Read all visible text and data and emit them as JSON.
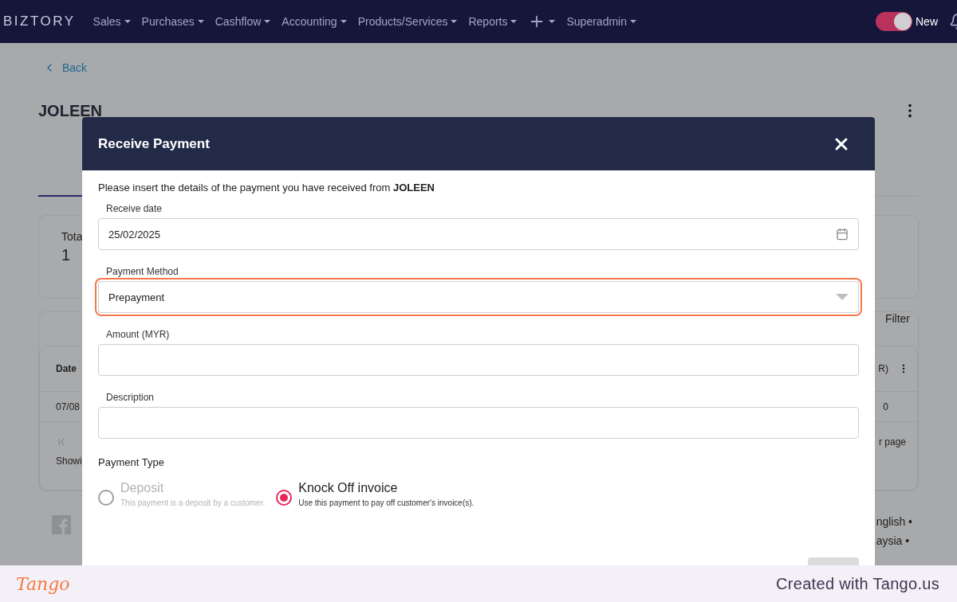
{
  "navbar": {
    "logo": "BIZTORY",
    "menu": [
      {
        "kind": "text",
        "label": "Sales"
      },
      {
        "kind": "text",
        "label": "Purchases"
      },
      {
        "kind": "text",
        "label": "Cashflow"
      },
      {
        "kind": "text",
        "label": "Accounting"
      },
      {
        "kind": "text",
        "label": "Products/Services"
      },
      {
        "kind": "text",
        "label": "Reports"
      },
      {
        "kind": "add"
      },
      {
        "kind": "text",
        "label": "Superadmin"
      }
    ],
    "toggle": {
      "label": "New",
      "on": true
    }
  },
  "background": {
    "back_link": "Back",
    "title": "JOLEEN",
    "stats": {
      "label": "Tota",
      "value": "1"
    },
    "table": {
      "filter": "Filter",
      "header": [
        "Date",
        "R)"
      ],
      "row": [
        "07/08",
        "0"
      ],
      "pagination": "r page",
      "showing": "Showi"
    },
    "footer_links": [
      "nglish •",
      "aysia •"
    ]
  },
  "modal": {
    "title": "Receive Payment",
    "intro": "Please insert the details of the payment you have received from **JOLEEN**",
    "fields": [
      {
        "kind": "date",
        "label": "Receive date",
        "value": "25/02/2025",
        "highlighted": false
      },
      {
        "kind": "select",
        "label": "Payment Method",
        "value": "Prepayment",
        "highlighted": true
      },
      {
        "kind": "text",
        "label": "Amount (MYR)",
        "highlighted": false
      },
      {
        "kind": "text",
        "label": "Description",
        "highlighted": false
      }
    ],
    "payment_type": {
      "label": "Payment Type",
      "options": [
        {
          "title": "Deposit",
          "description": "This payment is a deposit by a customer.",
          "selected": false,
          "disabled": true
        },
        {
          "title": "Knock Off invoice",
          "description": "Use this payment to pay off customer's invoice(s).",
          "selected": true,
          "disabled": false
        }
      ]
    }
  },
  "footer": {
    "brand": "Tango",
    "text": "Created with Tango.us"
  }
}
